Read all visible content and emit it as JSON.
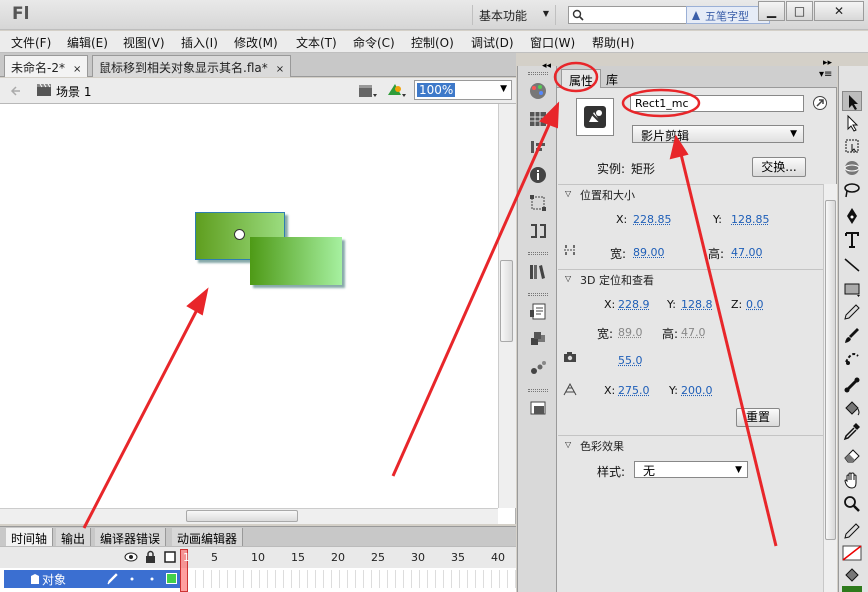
{
  "app": {
    "logo": "Fl",
    "workspace": "基本功能",
    "watermark": "五笔字型"
  },
  "window_buttons": {
    "minimize": "▁",
    "maximize": "□",
    "close": "✕"
  },
  "menu": [
    "文件(F)",
    "编辑(E)",
    "视图(V)",
    "插入(I)",
    "修改(M)",
    "文本(T)",
    "命令(C)",
    "控制(O)",
    "调试(D)",
    "窗口(W)",
    "帮助(H)"
  ],
  "doc_tabs": [
    {
      "label": "未命名-2*",
      "close": "×"
    },
    {
      "label": "鼠标移到相关对象显示其名.fla*",
      "close": "×"
    }
  ],
  "scene": {
    "label": "场景 1",
    "zoom": "100%"
  },
  "timeline": {
    "tabs": [
      "时间轴",
      "输出",
      "编译器错误",
      "动画编辑器"
    ],
    "frame_numbers": [
      "1",
      "5",
      "10",
      "15",
      "20",
      "25",
      "30",
      "35",
      "40"
    ],
    "layer_name": "对象"
  },
  "properties": {
    "tabs": [
      "属性",
      "库"
    ],
    "instance_name": "Rect1_mc",
    "symbol_type": "影片剪辑",
    "instance_label": "实例:",
    "instance_of": "矩形",
    "swap_button": "交换...",
    "position_size": {
      "header": "位置和大小",
      "x_label": "X:",
      "x": "228.85",
      "y_label": "Y:",
      "y": "128.85",
      "w_label": "宽:",
      "w": "89.00",
      "h_label": "高:",
      "h": "47.00"
    },
    "threed": {
      "header": "3D 定位和查看",
      "x_label": "X:",
      "x": "228.9",
      "y_label": "Y:",
      "y": "128.8",
      "z_label": "Z:",
      "z": "0.0",
      "w_label": "宽:",
      "w": "89.0",
      "h_label": "高:",
      "h": "47.0",
      "perspective": "55.0",
      "vp_x_label": "X:",
      "vp_x": "275.0",
      "vp_y_label": "Y:",
      "vp_y": "200.0",
      "reset_button": "重置"
    },
    "color_effect": {
      "header": "色彩效果",
      "style_label": "样式:",
      "style_value": "无"
    }
  },
  "colors": {
    "annotation": "#e8262a",
    "selection": "#3b6fd1",
    "symbol_fill_start": "#5f9e1f",
    "symbol_fill_end": "#9bdc7f"
  }
}
